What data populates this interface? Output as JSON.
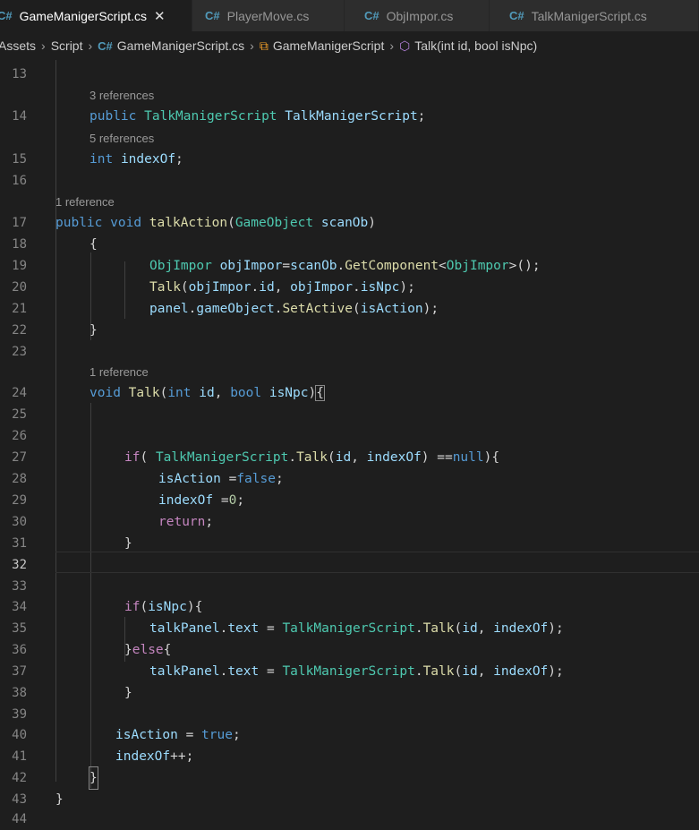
{
  "tabs": [
    {
      "label": "GameManigerScript.cs",
      "icon": "csharp-file-icon",
      "active": true
    },
    {
      "label": "PlayerMove.cs",
      "icon": "csharp-file-icon"
    },
    {
      "label": "ObjImpor.cs",
      "icon": "csharp-file-icon"
    },
    {
      "label": "TalkManigerScript.cs",
      "icon": "csharp-file-icon"
    }
  ],
  "breadcrumb": [
    "Assets",
    "Script",
    "GameManigerScript.cs",
    "GameManigerScript",
    "Talk(int id, bool isNpc)"
  ],
  "lenses": [
    "3 references",
    "5 references",
    "1 reference",
    "1 reference"
  ],
  "line_numbers": [
    "13",
    "14",
    "15",
    "16",
    "17",
    "18",
    "19",
    "20",
    "21",
    "22",
    "23",
    "24",
    "25",
    "26",
    "27",
    "28",
    "29",
    "30",
    "31",
    "32",
    "33",
    "34",
    "35",
    "36",
    "37",
    "38",
    "39",
    "40",
    "41",
    "42",
    "43",
    "44"
  ],
  "colors": {
    "background": "#1e1e1e",
    "keyword": "#569cd6",
    "type": "#4ec9b0",
    "function": "#dcdcaa",
    "variable": "#9cdcfe",
    "control": "#c586c0",
    "number": "#b5cea8"
  },
  "code": {
    "l14": [
      "public",
      "TalkManigerScript",
      "TalkManigerScript",
      ";"
    ],
    "l15": [
      "int",
      "indexOf",
      ";"
    ],
    "l17": [
      "public",
      "void",
      "talkAction",
      "(",
      "GameObject",
      "scanOb",
      ")"
    ],
    "l18": [
      "{"
    ],
    "l19": [
      "ObjImpor",
      "objImpor",
      "=",
      "scanOb",
      ".",
      "GetComponent",
      "<",
      "ObjImpor",
      ">();"
    ],
    "l20": [
      "Talk",
      "(",
      "objImpor",
      ".",
      "id",
      ", ",
      "objImpor",
      ".",
      "isNpc",
      ");"
    ],
    "l21": [
      "panel",
      ".",
      "gameObject",
      ".",
      "SetActive",
      "(",
      "isAction",
      ");"
    ],
    "l22": [
      "}"
    ],
    "l24": [
      "void",
      "Talk",
      "(",
      "int",
      "id",
      ", ",
      "bool",
      "isNpc",
      ")",
      "{"
    ],
    "l27": [
      "if",
      "( ",
      "TalkManigerScript",
      ".",
      "Talk",
      "(",
      "id",
      ", ",
      "indexOf",
      ") ==",
      "null",
      "){"
    ],
    "l28": [
      "isAction",
      " =",
      "false",
      ";"
    ],
    "l29": [
      "indexOf",
      " =",
      "0",
      ";"
    ],
    "l30": [
      "return",
      ";"
    ],
    "l31": [
      "}"
    ],
    "l34": [
      "if",
      "(",
      "isNpc",
      "){"
    ],
    "l35": [
      "talkPanel",
      ".",
      "text",
      " = ",
      "TalkManigerScript",
      ".",
      "Talk",
      "(",
      "id",
      ", ",
      "indexOf",
      ");"
    ],
    "l36": [
      "}",
      "else",
      "{"
    ],
    "l37": [
      "talkPanel",
      ".",
      "text",
      " = ",
      "TalkManigerScript",
      ".",
      "Talk",
      "(",
      "id",
      ", ",
      "indexOf",
      ");"
    ],
    "l38": [
      "}"
    ],
    "l40": [
      "isAction",
      " = ",
      "true",
      ";"
    ],
    "l41": [
      "indexOf",
      "++;"
    ],
    "l42": [
      "}"
    ],
    "l43": [
      "}"
    ]
  }
}
